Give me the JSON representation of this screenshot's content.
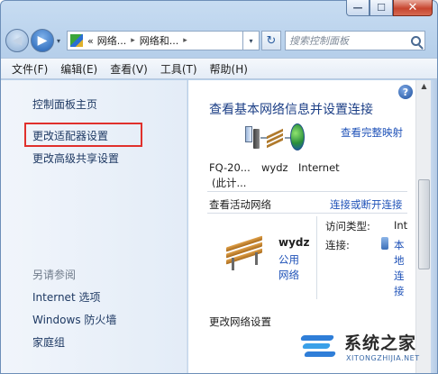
{
  "window": {
    "caption_buttons": {
      "minimize": "—",
      "maximize": "☐",
      "close": "✕"
    }
  },
  "navigation": {
    "back_label": "◀",
    "forward_label": "▶",
    "history_drop": "▾",
    "breadcrumb": [
      "网络...",
      "网络和..."
    ],
    "breadcrumb_prefix": "«",
    "breadcrumb_sep": "▸",
    "address_drop": "▾",
    "refresh_label": "↻",
    "search_placeholder": "搜索控制面板"
  },
  "menu": {
    "items": [
      "文件(F)",
      "编辑(E)",
      "查看(V)",
      "工具(T)",
      "帮助(H)"
    ]
  },
  "sidebar": {
    "home_link": "控制面板主页",
    "links": [
      "更改适配器设置",
      "更改高级共享设置"
    ],
    "see_also_heading": "另请参阅",
    "see_also": [
      "Internet 选项",
      "Windows 防火墙",
      "家庭组"
    ],
    "highlight_color": "#e0302c"
  },
  "main": {
    "help_label": "?",
    "heading": "查看基本网络信息并设置连接",
    "full_map_link": "查看完整映射",
    "map_nodes": [
      {
        "label_line1": "FQ-20...",
        "label_line2": "(此计..."
      },
      {
        "label_line1": "wydz",
        "label_line2": ""
      },
      {
        "label_line1": "Internet",
        "label_line2": ""
      }
    ],
    "active_networks_label": "查看活动网络",
    "connect_link": "连接或断开连接",
    "network": {
      "name": "wydz",
      "type_link": [
        "公用",
        "网络"
      ],
      "access_type_label": "访问类型:",
      "access_type_value": "Int",
      "connection_label": "连接:",
      "connection_value": [
        "本",
        "地",
        "连",
        "接"
      ]
    },
    "change_settings_label": "更改网络设置"
  },
  "watermark": {
    "title": "系统之家",
    "subtitle": "XITONGZHIJIA.NET"
  },
  "colors": {
    "link": "#1f52b8",
    "heading": "#1c3f86",
    "sidebar_bg": "#e8eff8"
  }
}
